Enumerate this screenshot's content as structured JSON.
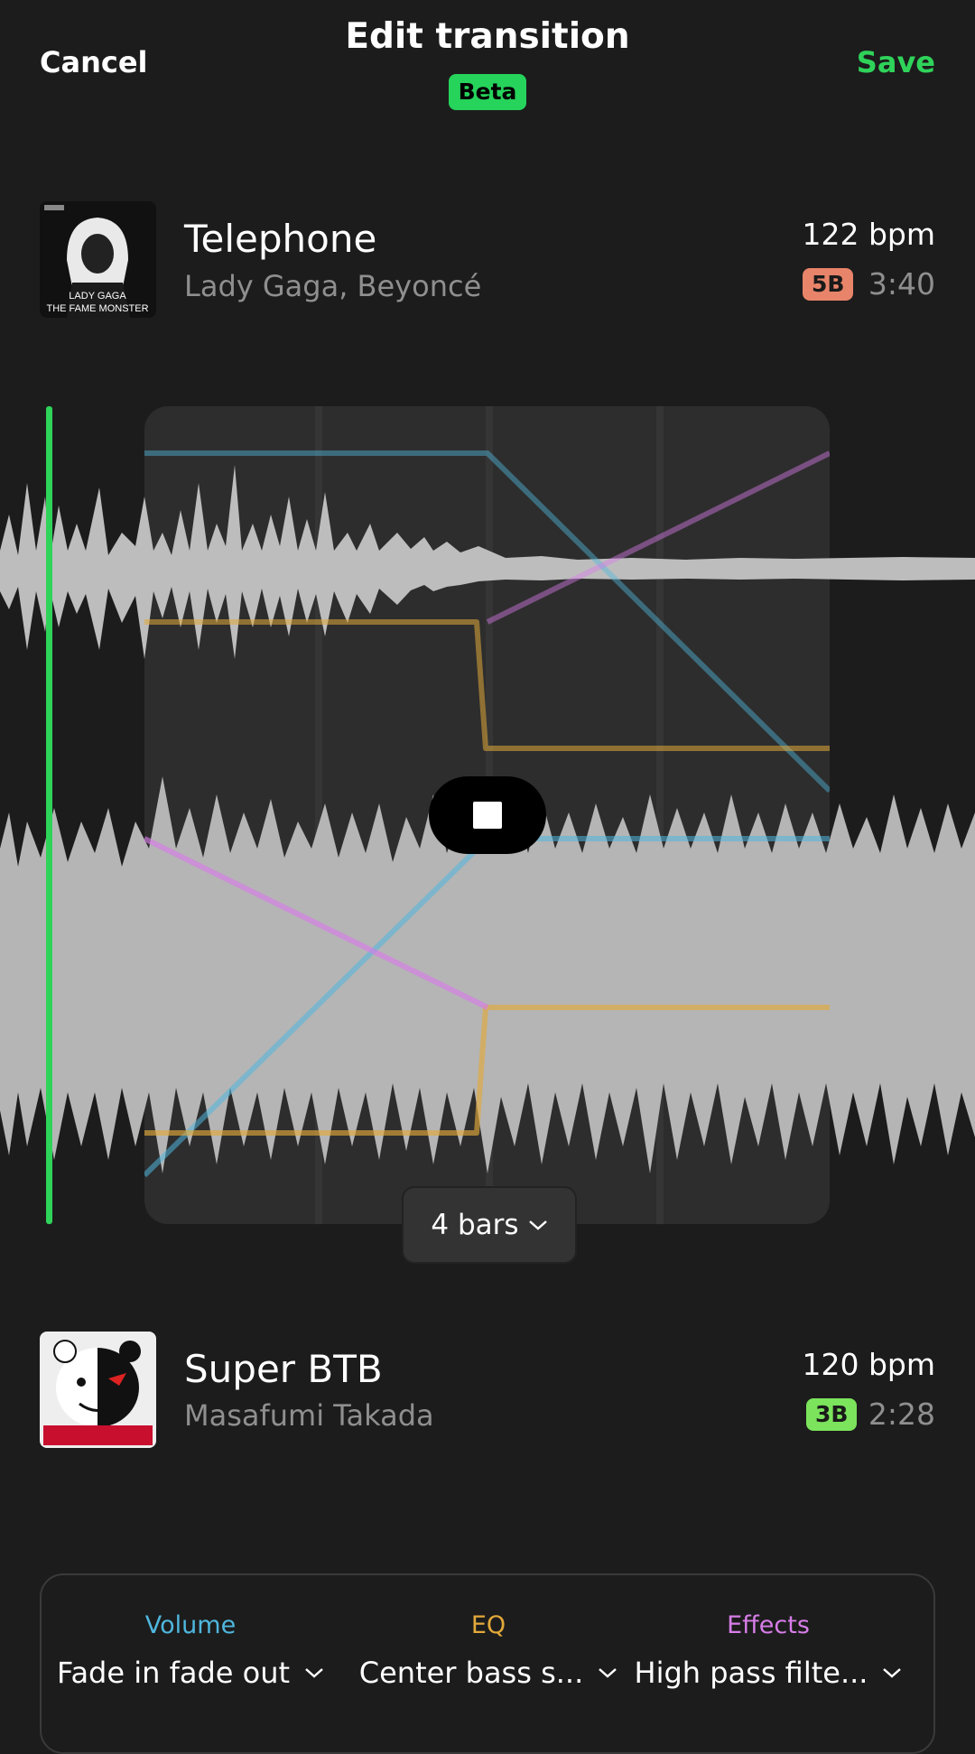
{
  "header": {
    "cancel_label": "Cancel",
    "title": "Edit transition",
    "badge": "Beta",
    "save_label": "Save"
  },
  "track_out": {
    "title": "Telephone",
    "artist": "Lady Gaga, Beyoncé",
    "bpm": "122 bpm",
    "key": "5B",
    "key_color": "#e8846a",
    "duration": "3:40",
    "art_text": "LADY GAGA\nTHE FAME MONSTER"
  },
  "track_in": {
    "title": "Super BTB",
    "artist": "Masafumi Takada",
    "bpm": "120 bpm",
    "key": "3B",
    "key_color": "#7be35c",
    "duration": "2:28"
  },
  "transition": {
    "length": "4 bars",
    "playhead_color": "#2fd35a"
  },
  "controls": [
    {
      "label": "Volume",
      "value": "Fade in fade out",
      "color": "#4fb7de"
    },
    {
      "label": "EQ",
      "value": "Center bass s...",
      "color": "#e2a93a"
    },
    {
      "label": "Effects",
      "value": "High pass filte...",
      "color": "#d77de8"
    }
  ],
  "colors": {
    "accent": "#2fd35a",
    "volume": "#4fb7de",
    "eq": "#e2a93a",
    "effects": "#d77de8"
  }
}
